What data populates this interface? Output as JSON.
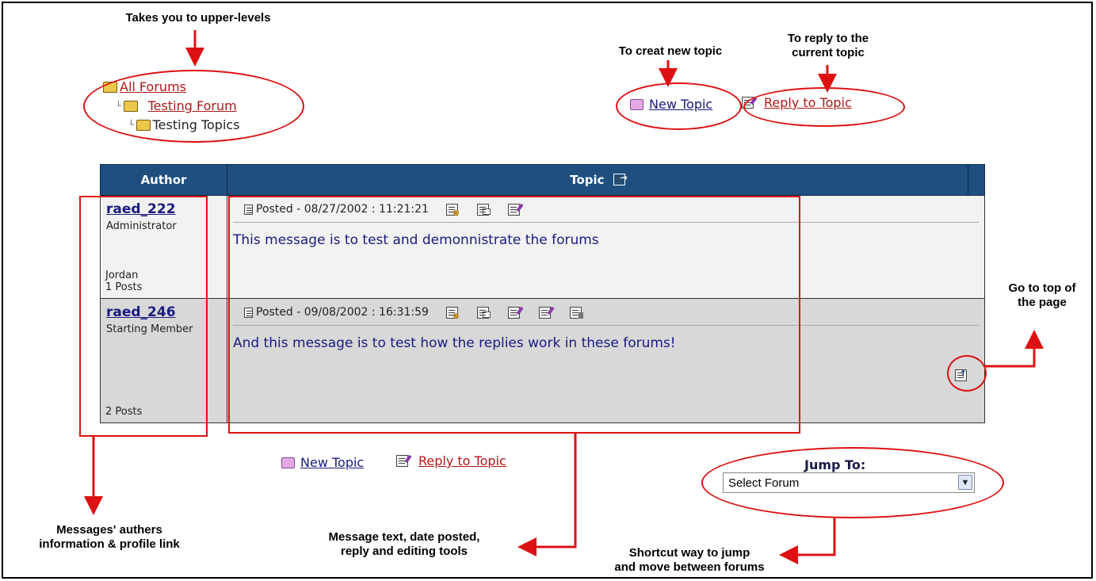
{
  "annotations": {
    "upper_levels": "Takes you to upper-levels",
    "new_topic_hint": "To creat new topic",
    "reply_hint_1": "To reply to the",
    "reply_hint_2": "current topic",
    "top_hint_1": "Go to top of",
    "top_hint_2": "the page",
    "authors_1": "Messages' authers",
    "authors_2": "information & profile link",
    "message_1": "Message text, date posted,",
    "message_2": "reply and editing tools",
    "jump_1": "Shortcut way to jump",
    "jump_2": "and move between forums"
  },
  "breadcrumb": {
    "all_forums": "All Forums",
    "testing_forum": "Testing Forum",
    "testing_topics": "Testing Topics"
  },
  "actions": {
    "new_topic": "New Topic",
    "reply_to_topic": "Reply to Topic"
  },
  "table": {
    "header_author": "Author",
    "header_topic": "Topic"
  },
  "posts": [
    {
      "author": "raed_222",
      "title": "Administrator",
      "location": "Jordan",
      "posts": "1 Posts",
      "posted": "Posted - 08/27/2002 :  11:21:21",
      "message": "This message is to test and demonnistrate the forums"
    },
    {
      "author": "raed_246",
      "title": "Starting Member",
      "location": "",
      "posts": "2 Posts",
      "posted": "Posted - 09/08/2002 :  16:31:59",
      "message": "And this message is to test how the replies work in these forums!"
    }
  ],
  "jump": {
    "label": "Jump To:",
    "selected": "Select Forum"
  },
  "colors": {
    "header": "#1f4f7f",
    "annotation": "#dd1111",
    "link_red": "#b01818",
    "link_blue": "#1a1a80"
  }
}
